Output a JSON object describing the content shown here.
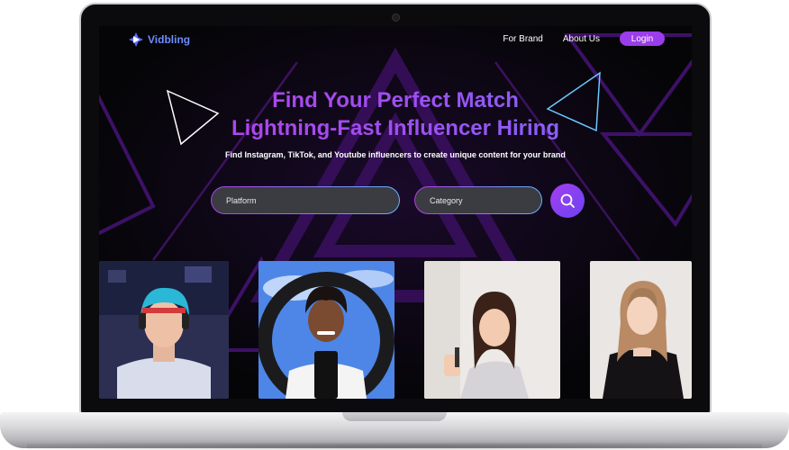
{
  "app": {
    "brand": "Vidbling"
  },
  "nav": {
    "for_brand": "For Brand",
    "about_us": "About Us",
    "login": "Login"
  },
  "hero": {
    "title_line1": "Find Your Perfect Match",
    "title_line2": "Lightning-Fast Influencer Hiring",
    "subtitle": "Find Instagram, TikTok, and Youtube influencers to create unique content for your brand"
  },
  "search": {
    "platform_placeholder": "Platform",
    "category_placeholder": "Category",
    "button_icon": "search-icon"
  },
  "influencer_cards": [
    {
      "name": "influencer-card-1",
      "image": "streamer-blue-hair-headphones"
    },
    {
      "name": "influencer-card-2",
      "image": "creator-ring-light-phone"
    },
    {
      "name": "influencer-card-3",
      "image": "creator-filming-selfie"
    },
    {
      "name": "influencer-card-4",
      "image": "creator-black-top"
    }
  ],
  "colors": {
    "accent_purple": "#9b3dea",
    "logo_blue": "#6d8cff",
    "background": "#060608"
  }
}
